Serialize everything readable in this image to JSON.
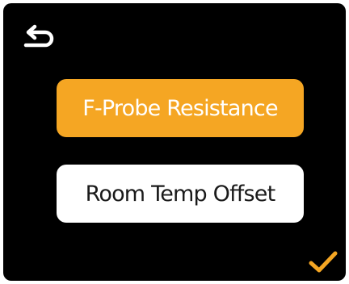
{
  "colors": {
    "screen_background": "#000000",
    "selected_option_background": "#f5a623",
    "selected_option_text": "#ffffff",
    "normal_option_background": "#ffffff",
    "normal_option_text": "#1a1a1a",
    "confirm_check": "#f5a623",
    "back_arrow": "#ffffff"
  },
  "icons": {
    "back": "back-arrow-icon",
    "confirm": "checkmark-icon"
  },
  "menu": {
    "options": [
      {
        "label": "F-Probe Resistance",
        "selected": true
      },
      {
        "label": "Room Temp Offset",
        "selected": false
      }
    ]
  }
}
